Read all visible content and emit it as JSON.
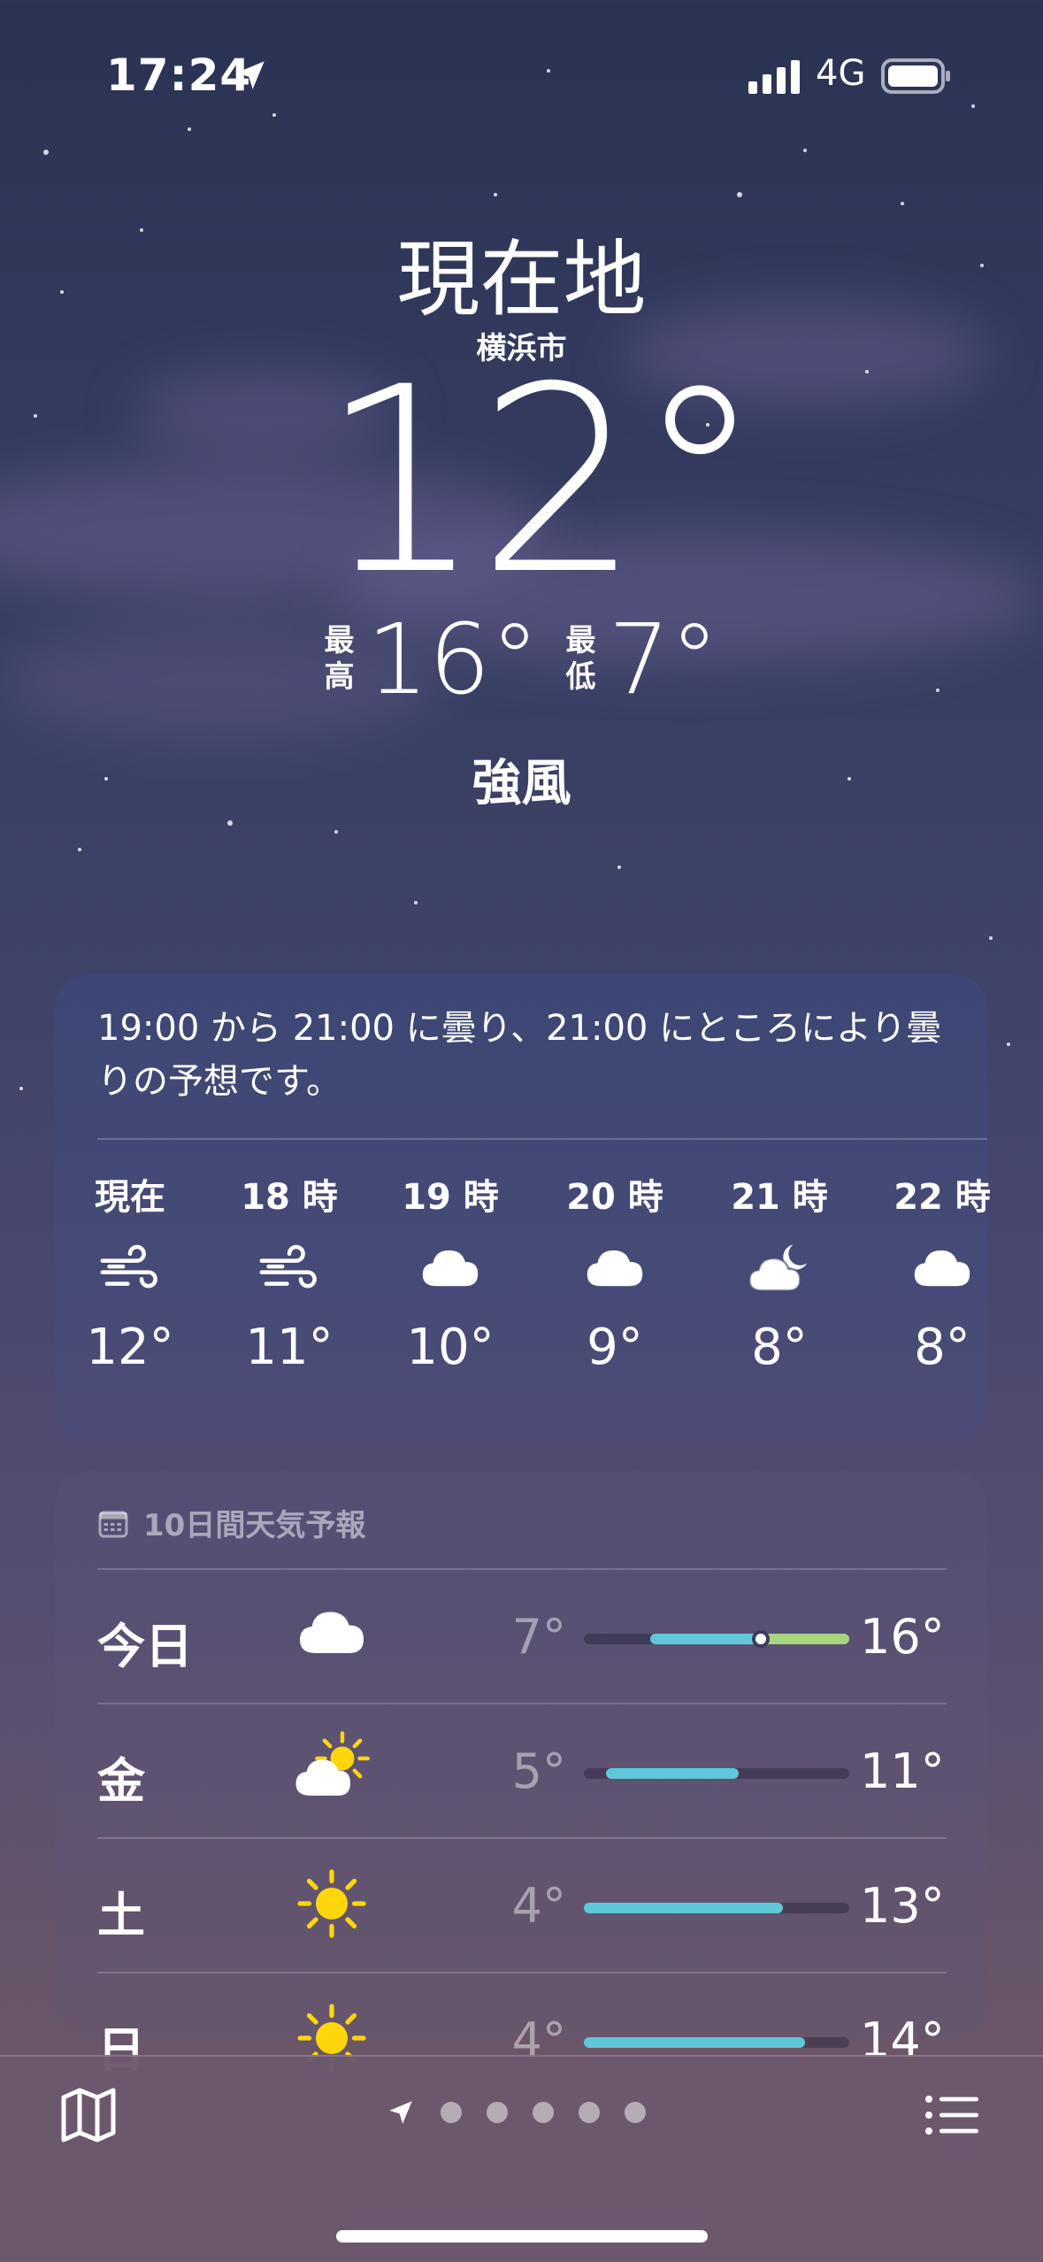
{
  "status_bar": {
    "time": "17:24",
    "network": "4G"
  },
  "header": {
    "location": "現在地",
    "city": "横浜市",
    "temperature": "12°",
    "high_label_1": "最",
    "high_label_2": "高",
    "high": "16°",
    "low_label_1": "最",
    "low_label_2": "低",
    "low": "7°",
    "condition": "強風"
  },
  "hourly": {
    "summary": "19:00 から 21:00 に曇り、21:00 にところにより曇りの予想です。",
    "items": [
      {
        "time": "現在",
        "icon": "wind-icon",
        "temp": "12°"
      },
      {
        "time": "18 時",
        "icon": "wind-icon",
        "temp": "11°"
      },
      {
        "time": "19 時",
        "icon": "cloud-icon",
        "temp": "10°"
      },
      {
        "time": "20 時",
        "icon": "cloud-icon",
        "temp": "9°"
      },
      {
        "time": "21 時",
        "icon": "cloud-moon-icon",
        "temp": "8°"
      },
      {
        "time": "22 時",
        "icon": "cloud-icon",
        "temp": "8°"
      }
    ]
  },
  "daily": {
    "title": "10日間天気予報",
    "range_min": 4,
    "range_max": 16,
    "items": [
      {
        "day": "今日",
        "icon": "cloud-icon",
        "low": "7°",
        "high": "16°",
        "low_val": 7,
        "high_val": 16,
        "current_val": 12
      },
      {
        "day": "金",
        "icon": "sun-cloud-icon",
        "low": "5°",
        "high": "11°",
        "low_val": 5,
        "high_val": 11
      },
      {
        "day": "土",
        "icon": "sun-icon",
        "low": "4°",
        "high": "13°",
        "low_val": 4,
        "high_val": 13
      },
      {
        "day": "日",
        "icon": "sun-icon",
        "low": "4°",
        "high": "14°",
        "low_val": 4,
        "high_val": 14
      }
    ]
  },
  "colors": {
    "range_fill_cool": "#5ec8d8",
    "range_fill_warm": "#a8d47a",
    "sun": "#ffd60a"
  }
}
